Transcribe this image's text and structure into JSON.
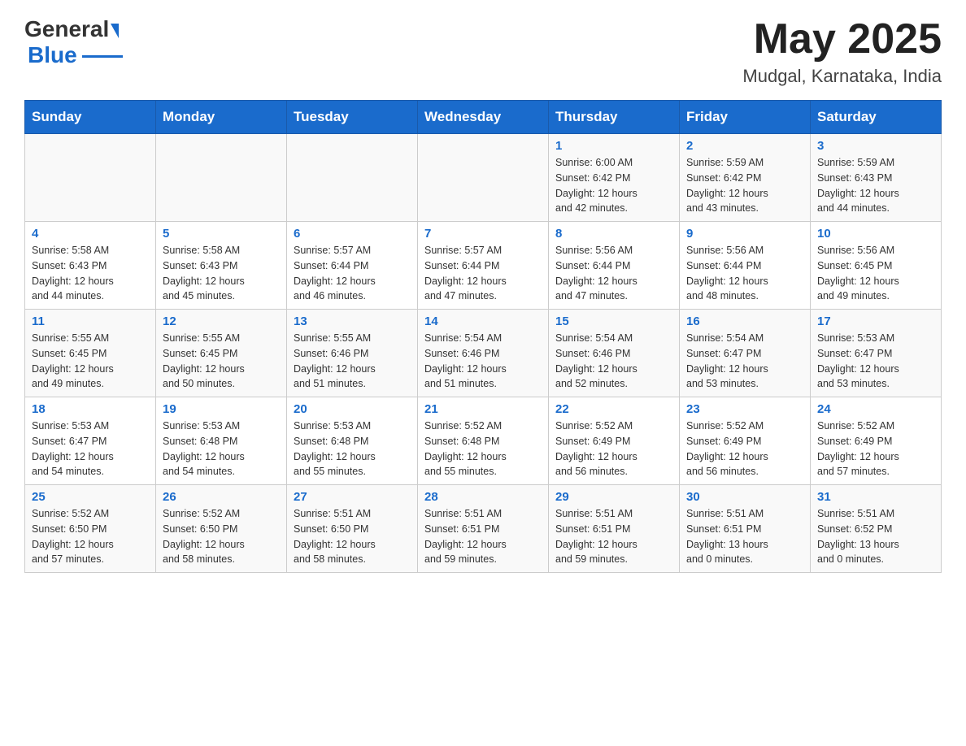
{
  "header": {
    "logo_general": "General",
    "logo_blue": "Blue",
    "month_year": "May 2025",
    "location": "Mudgal, Karnataka, India"
  },
  "days_of_week": [
    "Sunday",
    "Monday",
    "Tuesday",
    "Wednesday",
    "Thursday",
    "Friday",
    "Saturday"
  ],
  "weeks": [
    [
      {
        "day": "",
        "info": ""
      },
      {
        "day": "",
        "info": ""
      },
      {
        "day": "",
        "info": ""
      },
      {
        "day": "",
        "info": ""
      },
      {
        "day": "1",
        "info": "Sunrise: 6:00 AM\nSunset: 6:42 PM\nDaylight: 12 hours\nand 42 minutes."
      },
      {
        "day": "2",
        "info": "Sunrise: 5:59 AM\nSunset: 6:42 PM\nDaylight: 12 hours\nand 43 minutes."
      },
      {
        "day": "3",
        "info": "Sunrise: 5:59 AM\nSunset: 6:43 PM\nDaylight: 12 hours\nand 44 minutes."
      }
    ],
    [
      {
        "day": "4",
        "info": "Sunrise: 5:58 AM\nSunset: 6:43 PM\nDaylight: 12 hours\nand 44 minutes."
      },
      {
        "day": "5",
        "info": "Sunrise: 5:58 AM\nSunset: 6:43 PM\nDaylight: 12 hours\nand 45 minutes."
      },
      {
        "day": "6",
        "info": "Sunrise: 5:57 AM\nSunset: 6:44 PM\nDaylight: 12 hours\nand 46 minutes."
      },
      {
        "day": "7",
        "info": "Sunrise: 5:57 AM\nSunset: 6:44 PM\nDaylight: 12 hours\nand 47 minutes."
      },
      {
        "day": "8",
        "info": "Sunrise: 5:56 AM\nSunset: 6:44 PM\nDaylight: 12 hours\nand 47 minutes."
      },
      {
        "day": "9",
        "info": "Sunrise: 5:56 AM\nSunset: 6:44 PM\nDaylight: 12 hours\nand 48 minutes."
      },
      {
        "day": "10",
        "info": "Sunrise: 5:56 AM\nSunset: 6:45 PM\nDaylight: 12 hours\nand 49 minutes."
      }
    ],
    [
      {
        "day": "11",
        "info": "Sunrise: 5:55 AM\nSunset: 6:45 PM\nDaylight: 12 hours\nand 49 minutes."
      },
      {
        "day": "12",
        "info": "Sunrise: 5:55 AM\nSunset: 6:45 PM\nDaylight: 12 hours\nand 50 minutes."
      },
      {
        "day": "13",
        "info": "Sunrise: 5:55 AM\nSunset: 6:46 PM\nDaylight: 12 hours\nand 51 minutes."
      },
      {
        "day": "14",
        "info": "Sunrise: 5:54 AM\nSunset: 6:46 PM\nDaylight: 12 hours\nand 51 minutes."
      },
      {
        "day": "15",
        "info": "Sunrise: 5:54 AM\nSunset: 6:46 PM\nDaylight: 12 hours\nand 52 minutes."
      },
      {
        "day": "16",
        "info": "Sunrise: 5:54 AM\nSunset: 6:47 PM\nDaylight: 12 hours\nand 53 minutes."
      },
      {
        "day": "17",
        "info": "Sunrise: 5:53 AM\nSunset: 6:47 PM\nDaylight: 12 hours\nand 53 minutes."
      }
    ],
    [
      {
        "day": "18",
        "info": "Sunrise: 5:53 AM\nSunset: 6:47 PM\nDaylight: 12 hours\nand 54 minutes."
      },
      {
        "day": "19",
        "info": "Sunrise: 5:53 AM\nSunset: 6:48 PM\nDaylight: 12 hours\nand 54 minutes."
      },
      {
        "day": "20",
        "info": "Sunrise: 5:53 AM\nSunset: 6:48 PM\nDaylight: 12 hours\nand 55 minutes."
      },
      {
        "day": "21",
        "info": "Sunrise: 5:52 AM\nSunset: 6:48 PM\nDaylight: 12 hours\nand 55 minutes."
      },
      {
        "day": "22",
        "info": "Sunrise: 5:52 AM\nSunset: 6:49 PM\nDaylight: 12 hours\nand 56 minutes."
      },
      {
        "day": "23",
        "info": "Sunrise: 5:52 AM\nSunset: 6:49 PM\nDaylight: 12 hours\nand 56 minutes."
      },
      {
        "day": "24",
        "info": "Sunrise: 5:52 AM\nSunset: 6:49 PM\nDaylight: 12 hours\nand 57 minutes."
      }
    ],
    [
      {
        "day": "25",
        "info": "Sunrise: 5:52 AM\nSunset: 6:50 PM\nDaylight: 12 hours\nand 57 minutes."
      },
      {
        "day": "26",
        "info": "Sunrise: 5:52 AM\nSunset: 6:50 PM\nDaylight: 12 hours\nand 58 minutes."
      },
      {
        "day": "27",
        "info": "Sunrise: 5:51 AM\nSunset: 6:50 PM\nDaylight: 12 hours\nand 58 minutes."
      },
      {
        "day": "28",
        "info": "Sunrise: 5:51 AM\nSunset: 6:51 PM\nDaylight: 12 hours\nand 59 minutes."
      },
      {
        "day": "29",
        "info": "Sunrise: 5:51 AM\nSunset: 6:51 PM\nDaylight: 12 hours\nand 59 minutes."
      },
      {
        "day": "30",
        "info": "Sunrise: 5:51 AM\nSunset: 6:51 PM\nDaylight: 13 hours\nand 0 minutes."
      },
      {
        "day": "31",
        "info": "Sunrise: 5:51 AM\nSunset: 6:52 PM\nDaylight: 13 hours\nand 0 minutes."
      }
    ]
  ]
}
